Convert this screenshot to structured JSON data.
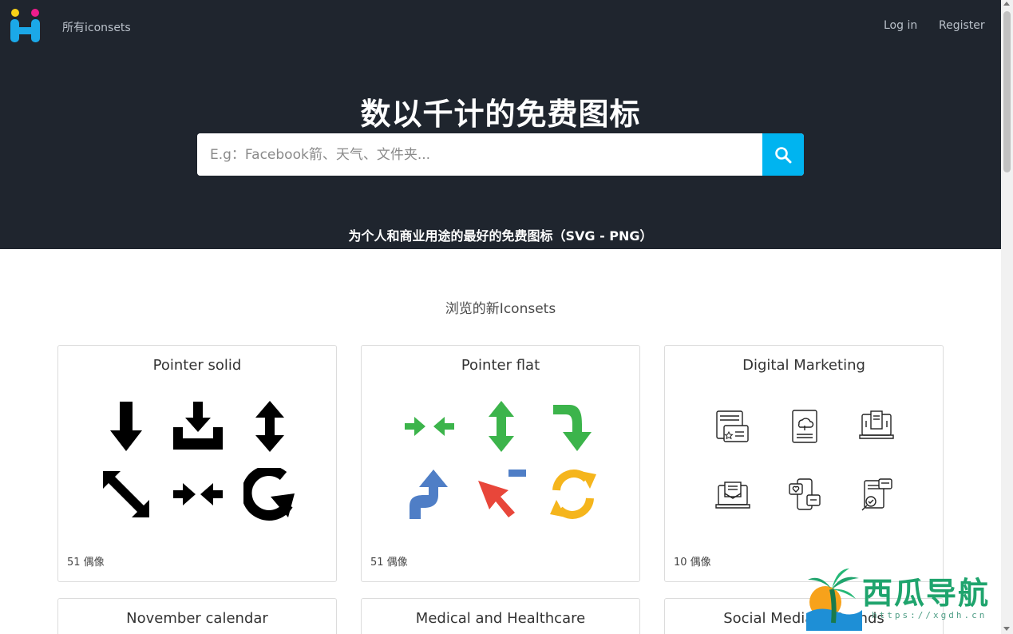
{
  "nav": {
    "all_iconsets": "所有iconsets",
    "login": "Log in",
    "register": "Register"
  },
  "hero": {
    "title": "数以千计的免费图标",
    "search_placeholder": "E.g：Facebook箭、天气、文件夹...",
    "subtitle": "为个人和商业用途的最好的免费图标（SVG - PNG）"
  },
  "section": {
    "title": "浏览的新Iconsets"
  },
  "cards": [
    {
      "title": "Pointer solid",
      "count": "51 偶像",
      "icons": [
        "arrow-down-icon",
        "download-tray-icon",
        "arrow-up-down-icon",
        "arrow-diagonal-icon",
        "arrows-inward-icon",
        "arrow-circular-g-icon"
      ]
    },
    {
      "title": "Pointer flat",
      "count": "51 偶像",
      "icons": [
        "arrows-inward-green-icon",
        "arrow-up-down-green-icon",
        "arrow-turn-down-green-icon",
        "arrow-turn-up-blue-icon",
        "cursor-red-icon",
        "refresh-yellow-icon"
      ]
    },
    {
      "title": "Digital Marketing",
      "count": "10 偶像",
      "icons": [
        "newspaper-card-icon",
        "document-cloud-icon",
        "laptop-document-icon",
        "laptop-mail-icon",
        "phone-social-icon",
        "document-search-icon"
      ]
    },
    {
      "title": "November calendar"
    },
    {
      "title": "Medical and Healthcare"
    },
    {
      "title": "Social Media & Brands"
    }
  ],
  "watermark": {
    "text": "西瓜导航",
    "url": "https://xgdh.cn"
  },
  "colors": {
    "hero_bg": "#1f252e",
    "search_button": "#00b4f0",
    "green": "#3cb44b",
    "blue": "#4f7ec6",
    "red": "#e8463a",
    "yellow": "#f5b51c"
  }
}
